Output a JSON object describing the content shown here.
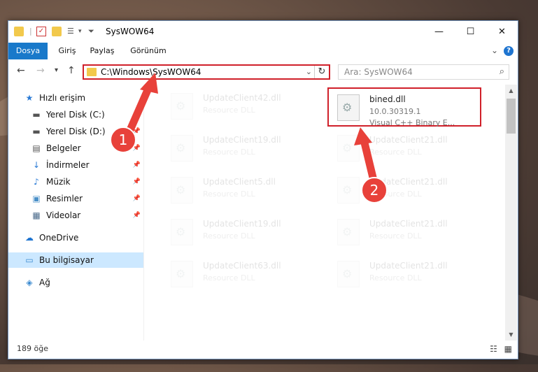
{
  "window": {
    "title": "SysWOW64",
    "minimize": "—",
    "maximize": "☐",
    "close": "✕"
  },
  "ribbon": {
    "tabs": [
      "Dosya",
      "Giriş",
      "Paylaş",
      "Görünüm"
    ],
    "help": "?"
  },
  "nav": {
    "back": "←",
    "forward": "→",
    "recent": "▾",
    "up": "↑",
    "address": "C:\\Windows\\SysWOW64",
    "search_placeholder": "Ara: SysWOW64"
  },
  "sidebar": {
    "items": [
      {
        "label": "Hızlı erişim",
        "icon": "star-icon",
        "pinned": false
      },
      {
        "label": "Yerel Disk (C:)",
        "icon": "drive-icon",
        "pinned": true
      },
      {
        "label": "Yerel Disk (D:)",
        "icon": "drive-icon",
        "pinned": true
      },
      {
        "label": "Belgeler",
        "icon": "document-icon",
        "pinned": true
      },
      {
        "label": "İndirmeler",
        "icon": "download-icon",
        "pinned": true
      },
      {
        "label": "Müzik",
        "icon": "music-icon",
        "pinned": true
      },
      {
        "label": "Resimler",
        "icon": "picture-icon",
        "pinned": true
      },
      {
        "label": "Videolar",
        "icon": "video-icon",
        "pinned": true
      },
      {
        "label": "OneDrive",
        "icon": "cloud-icon",
        "pinned": false
      },
      {
        "label": "Bu bilgisayar",
        "icon": "computer-icon",
        "pinned": false,
        "selected": true
      },
      {
        "label": "Ağ",
        "icon": "network-icon",
        "pinned": false
      }
    ]
  },
  "files": {
    "highlighted": {
      "name": "bined.dll",
      "version": "10.0.30319.1",
      "type": "Visual C++ Binary E..."
    },
    "left_column": [
      {
        "name": "UpdateClient42.dll",
        "type": "Resource DLL"
      },
      {
        "name": "UpdateClient19.dll",
        "type": "Resource DLL"
      },
      {
        "name": "UpdateClient5.dll",
        "type": "Resource DLL"
      },
      {
        "name": "UpdateClient19.dll",
        "type": "Resource DLL"
      },
      {
        "name": "UpdateClient63.dll",
        "type": "Resource DLL"
      }
    ],
    "right_column": [
      {
        "name": "UpdateClient21.dll",
        "type": "Resource DLL"
      },
      {
        "name": "UpdateClient21.dll",
        "type": "Resource DLL"
      },
      {
        "name": "UpdateClient21.dll",
        "type": "Resource DLL"
      },
      {
        "name": "UpdateClient21.dll",
        "type": "Resource DLL"
      }
    ]
  },
  "status": {
    "item_count": "189 öğe"
  },
  "annotations": {
    "step1": "1",
    "step2": "2",
    "color": "#e8413a"
  }
}
